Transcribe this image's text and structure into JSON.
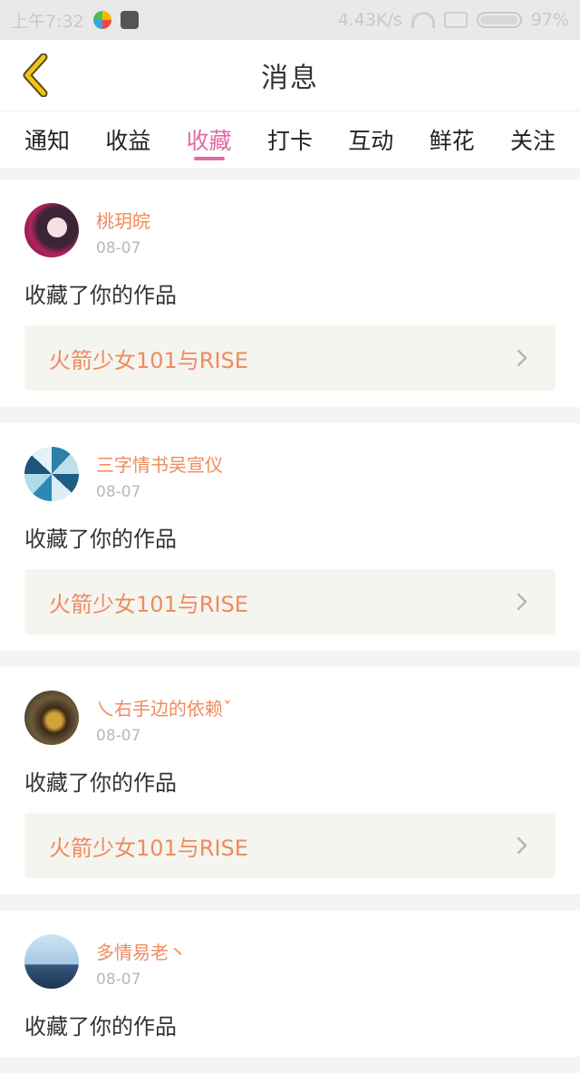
{
  "status_bar": {
    "time": "上午7:32",
    "speed": "4.43K/s",
    "battery": "97%",
    "battery_level": 0.97
  },
  "header": {
    "title": "消息"
  },
  "tabs": [
    {
      "label": "通知",
      "active": false
    },
    {
      "label": "收益",
      "active": false
    },
    {
      "label": "收藏",
      "active": true
    },
    {
      "label": "打卡",
      "active": false
    },
    {
      "label": "互动",
      "active": false
    },
    {
      "label": "鲜花",
      "active": false
    },
    {
      "label": "关注",
      "active": false
    }
  ],
  "notifications": [
    {
      "username": "桃玥皖",
      "date": "08-07",
      "action": "收藏了你的作品",
      "work_title": "火箭少女101与RISE"
    },
    {
      "username": "三字情书吴宣仪",
      "date": "08-07",
      "action": "收藏了你的作品",
      "work_title": "火箭少女101与RISE"
    },
    {
      "username": "乀右手边的依赖ˇ",
      "date": "08-07",
      "action": "收藏了你的作品",
      "work_title": "火箭少女101与RISE"
    },
    {
      "username": "多情易老丶",
      "date": "08-07",
      "action": "收藏了你的作品",
      "work_title": ""
    }
  ],
  "colors": {
    "accent_pink": "#e36aa3",
    "username_orange": "#f08a5d",
    "back_arrow_yellow": "#f2c418"
  }
}
